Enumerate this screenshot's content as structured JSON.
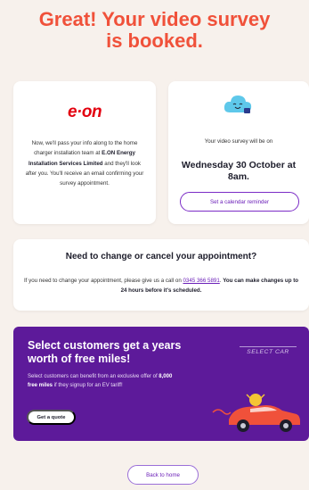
{
  "headline": {
    "line1": "Great! Your video survey",
    "line2": "is booked."
  },
  "eon_card": {
    "logo_text": "e·on",
    "text_before": "Now, we'll pass your info along to the home charger installation team at ",
    "company": "E.ON Energy Installation Services Limited",
    "text_after": " and they'll look after you. You'll receive an email confirming your survey appointment."
  },
  "survey_card": {
    "icon": "video-cloud-icon",
    "label": "Your video survey will be on",
    "date": "Wednesday 30 October at 8am.",
    "reminder_button": "Set a calendar reminder"
  },
  "change_card": {
    "title": "Need to change or cancel your appointment?",
    "text_before": "If you need to change your appointment, please give us a call on ",
    "phone": "0345 366 5891",
    "text_after": "You can make changes up to 24 hours before it's scheduled."
  },
  "promo": {
    "title": "Select customers get a years worth of free miles!",
    "text_before": "Select customers can benefit from an exclusive offer of ",
    "highlight": "8,000 free miles",
    "text_after": " if they signup for an EV tariff!",
    "button": "Get a quote",
    "partner_logo": "SELECT CAR",
    "background_color": "#5d1a9a"
  },
  "footer": {
    "home_button": "Back to home"
  },
  "colors": {
    "accent": "#f0513a",
    "brand_purple": "#6b1fb8",
    "eon_red": "#e3000f",
    "background": "#f7f1ec"
  }
}
